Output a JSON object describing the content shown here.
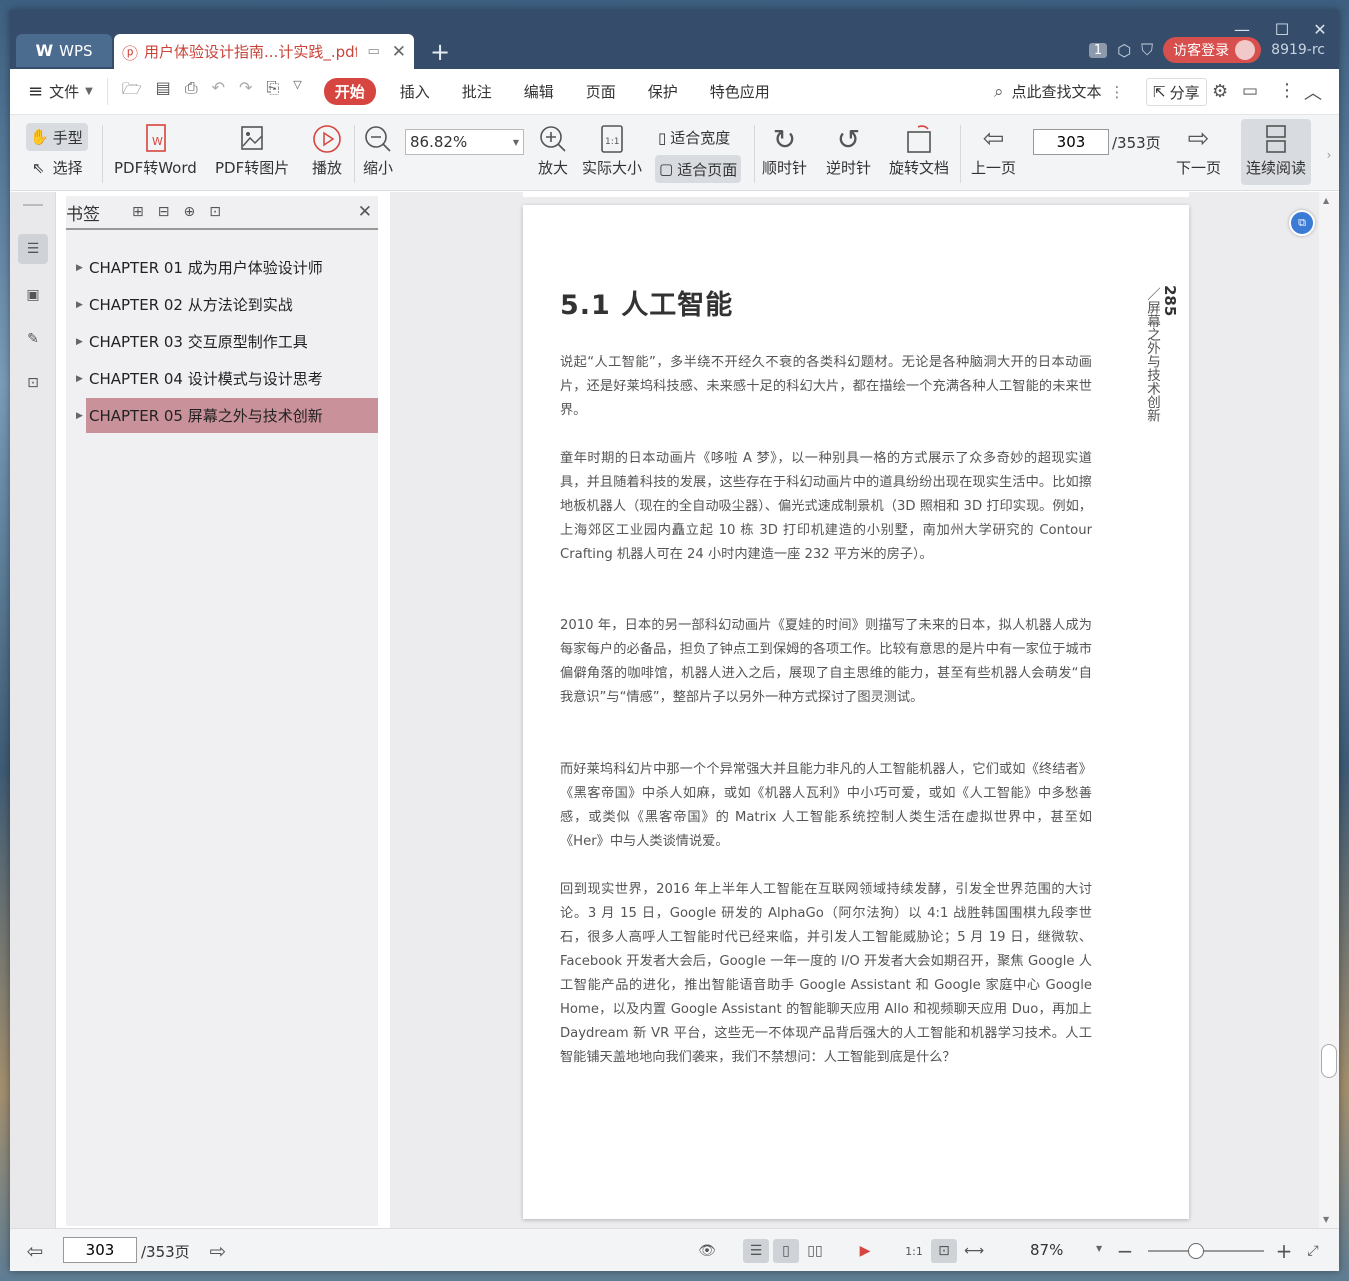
{
  "window": {
    "tabs": [
      {
        "label": "WPS"
      },
      {
        "label": "用户体验设计指南...计实践_.pdf"
      }
    ],
    "badge_count": "1",
    "login_label": "访客登录",
    "user_label": "8919-rc"
  },
  "menu": {
    "file_label": "文件",
    "items": [
      "开始",
      "插入",
      "批注",
      "编辑",
      "页面",
      "保护",
      "特色应用"
    ],
    "search_label": "点此查找文本",
    "share_label": "分享"
  },
  "toolbar": {
    "hand_label": "手型",
    "select_label": "选择",
    "pdf_to_word": "PDF转Word",
    "pdf_to_image": "PDF转图片",
    "play": "播放",
    "zoom_out": "缩小",
    "zoom_value": "86.82%",
    "zoom_in": "放大",
    "actual_size": "实际大小",
    "fit_width": "适合宽度",
    "fit_page": "适合页面",
    "clockwise": "顺时针",
    "counterclockwise": "逆时针",
    "rotate_doc": "旋转文档",
    "prev_page": "上一页",
    "page_current": "303",
    "page_total": "/353页",
    "next_page": "下一页",
    "continuous": "连续阅读"
  },
  "bookmarks": {
    "title": "书签",
    "items": [
      "CHAPTER 01 成为用户体验设计师",
      "CHAPTER 02 从方法论到实战",
      "CHAPTER 03 交互原型制作工具",
      "CHAPTER 04 设计模式与设计思考",
      "CHAPTER 05 屏幕之外与技术创新"
    ]
  },
  "document": {
    "heading": "5.1  人工智能",
    "side_note": "／屏幕之外与技术创新",
    "page_number": "285",
    "paragraphs": [
      "说起“人工智能”，多半绕不开经久不衰的各类科幻题材。无论是各种脑洞大开的日本动画片，还是好莱坞科技感、未来感十足的科幻大片，都在描绘一个充满各种人工智能的未来世界。",
      "童年时期的日本动画片《哆啦 A 梦》，以一种别具一格的方式展示了众多奇妙的超现实道具，并且随着科技的发展，这些存在于科幻动画片中的道具纷纷出现在现实生活中。比如擦地板机器人（现在的全自动吸尘器）、偏光式速成制景机（3D 照相和 3D 打印实现。例如，上海郊区工业园内矗立起 10 栋 3D 打印机建造的小别墅，南加州大学研究的 Contour Crafting 机器人可在 24 小时内建造一座 232 平方米的房子）。",
      "2010 年，日本的另一部科幻动画片《夏娃的时间》则描写了未来的日本，拟人机器人成为每家每户的必备品，担负了钟点工到保姆的各项工作。比较有意思的是片中有一家位于城市偏僻角落的咖啡馆，机器人进入之后，展现了自主思维的能力，甚至有些机器人会萌发“自我意识”与“情感”，整部片子以另外一种方式探讨了图灵测试。",
      "而好莱坞科幻片中那一个个异常强大并且能力非凡的人工智能机器人，它们或如《终结者》《黑客帝国》中杀人如麻，或如《机器人瓦利》中小巧可爱，或如《人工智能》中多愁善感，或类似《黑客帝国》的 Matrix 人工智能系统控制人类生活在虚拟世界中，甚至如《Her》中与人类谈情说爱。",
      "回到现实世界，2016 年上半年人工智能在互联网领域持续发酵，引发全世界范围的大讨论。3 月 15 日，Google 研发的 AlphaGo（阿尔法狗）以 4:1 战胜韩国围棋九段李世石，很多人高呼人工智能时代已经来临，并引发人工智能威胁论；5 月 19 日，继微软、Facebook 开发者大会后，Google 一年一度的 I/O 开发者大会如期召开，聚焦 Google 人工智能产品的进化，推出智能语音助手 Google Assistant 和 Google 家庭中心 Google Home，以及内置 Google Assistant 的智能聊天应用 Allo 和视频聊天应用 Duo，再加上 Daydream 新 VR 平台，这些无一不体现产品背后强大的人工智能和机器学习技术。人工智能铺天盖地地向我们袭来，我们不禁想问：人工智能到底是什么？"
    ]
  },
  "status": {
    "page_current": "303",
    "page_total": "/353页",
    "zoom": "87%"
  }
}
